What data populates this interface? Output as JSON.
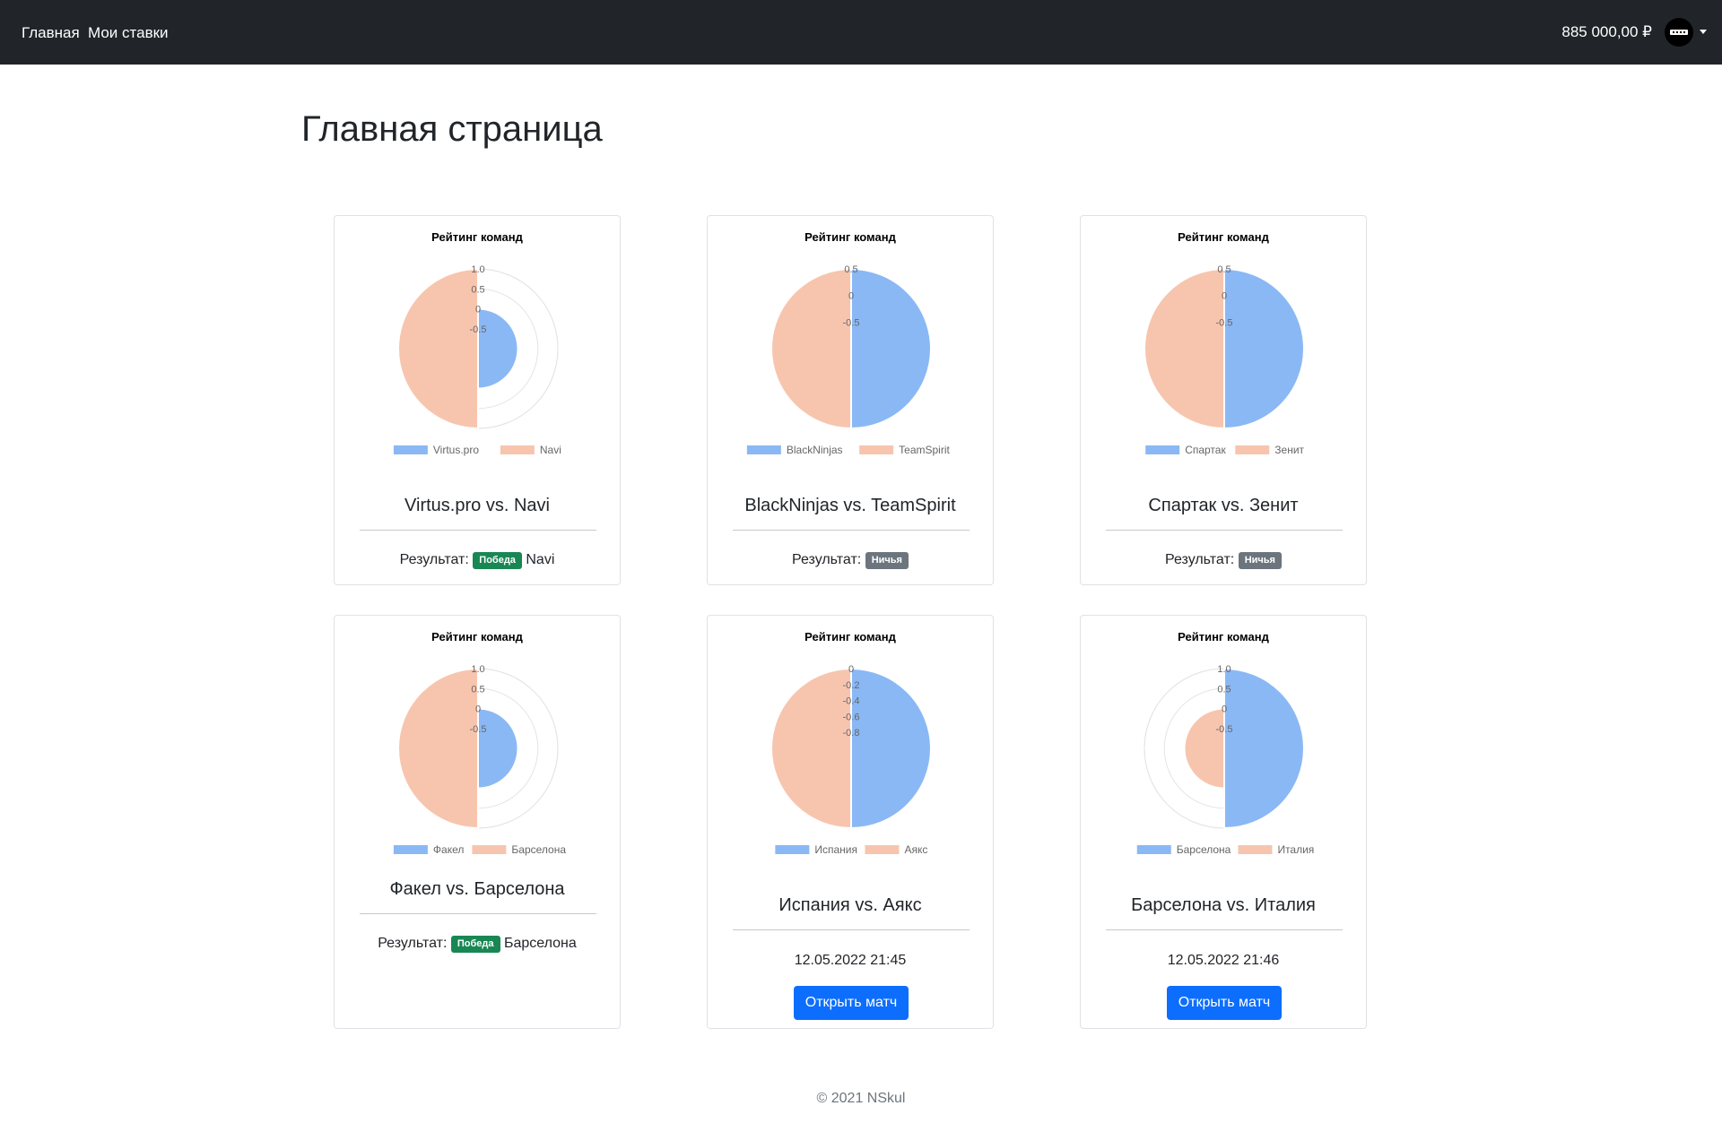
{
  "nav": {
    "home": "Главная",
    "my_bets": "Мои ставки",
    "balance": "885 000,00 ₽"
  },
  "page_title": "Главная страница",
  "result_label": "Результат:",
  "footer": "© 2021 NSkul",
  "colors": {
    "team_a": "#8ab8f5",
    "team_b": "#f7c5ae",
    "win_badge": "#198754",
    "draw_badge": "#6c757d",
    "primary": "#0d6efd"
  },
  "cards": [
    {
      "match": "Virtus.pro vs. Navi",
      "status": "result",
      "badge": "Победа",
      "badge_type": "win",
      "winner": "Navi",
      "chart_data": {
        "type": "polarArea",
        "title": "Рейтинг команд",
        "labels": [
          "Virtus.pro",
          "Navi"
        ],
        "values": [
          0,
          1
        ],
        "r_min": -1,
        "r_max": 1,
        "ticks": [
          "1.0",
          "0.5",
          "0",
          "-0.5"
        ]
      }
    },
    {
      "match": "BlackNinjas vs. TeamSpirit",
      "status": "result",
      "badge": "Ничья",
      "badge_type": "draw",
      "winner": "",
      "chart_data": {
        "type": "polarArea",
        "title": "Рейтинг команд",
        "labels": [
          "BlackNinjas",
          "TeamSpirit"
        ],
        "values": [
          0.5,
          0.5
        ],
        "r_min": -1,
        "r_max": 0.5,
        "ticks": [
          "0.5",
          "0",
          "-0.5"
        ]
      }
    },
    {
      "match": "Спартак vs. Зенит",
      "status": "result",
      "badge": "Ничья",
      "badge_type": "draw",
      "winner": "",
      "chart_data": {
        "type": "polarArea",
        "title": "Рейтинг команд",
        "labels": [
          "Спартак",
          "Зенит"
        ],
        "values": [
          0.5,
          0.5
        ],
        "r_min": -1,
        "r_max": 0.5,
        "ticks": [
          "0.5",
          "0",
          "-0.5"
        ]
      }
    },
    {
      "match": "Факел vs. Барселона",
      "status": "result",
      "badge": "Победа",
      "badge_type": "win",
      "winner": "Барселона",
      "chart_data": {
        "type": "polarArea",
        "title": "Рейтинг команд",
        "labels": [
          "Факел",
          "Барселона"
        ],
        "values": [
          0,
          1
        ],
        "r_min": -1,
        "r_max": 1,
        "ticks": [
          "1.0",
          "0.5",
          "0",
          "-0.5"
        ]
      }
    },
    {
      "match": "Испания vs. Аякс",
      "status": "upcoming",
      "date": "12.05.2022 21:45",
      "button": "Открыть матч",
      "chart_data": {
        "type": "polarArea",
        "title": "Рейтинг команд",
        "labels": [
          "Испания",
          "Аякс"
        ],
        "values": [
          0,
          0
        ],
        "r_min": -1,
        "r_max": 0,
        "ticks": [
          "0",
          "-0.2",
          "-0.4",
          "-0.6",
          "-0.8"
        ]
      }
    },
    {
      "match": "Барселона vs. Италия",
      "status": "upcoming",
      "date": "12.05.2022 21:46",
      "button": "Открыть матч",
      "chart_data": {
        "type": "polarArea",
        "title": "Рейтинг команд",
        "labels": [
          "Барселона",
          "Италия"
        ],
        "values": [
          1,
          0
        ],
        "r_min": -1,
        "r_max": 1,
        "ticks": [
          "1.0",
          "0.5",
          "0",
          "-0.5"
        ]
      }
    }
  ]
}
